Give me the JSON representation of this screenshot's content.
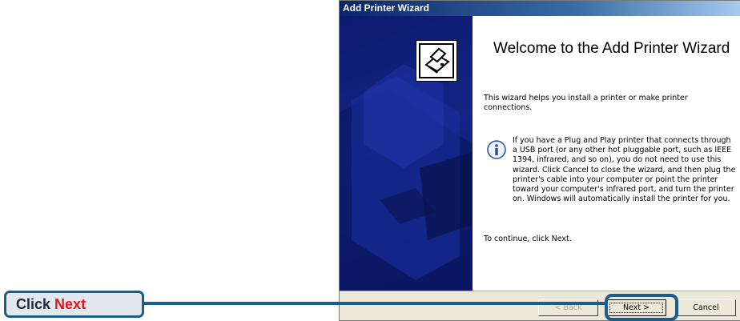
{
  "window": {
    "title": "Add Printer Wizard"
  },
  "content": {
    "heading": "Welcome to the Add Printer Wizard",
    "intro": "This wizard helps you install a printer or make printer connections.",
    "info": "If you have a Plug and Play printer that connects through a USB port (or any other hot pluggable port, such as IEEE 1394, infrared, and so on), you do not need to use this wizard. Click Cancel to close the wizard, and then plug the printer's cable into your computer or point the printer toward your computer's infrared port, and turn the printer on. Windows will automatically install the printer for you.",
    "continue": "To continue, click Next."
  },
  "buttons": {
    "back": "< Back",
    "next": "Next >",
    "cancel": "Cancel"
  },
  "callout": {
    "prefix": "Click",
    "highlight": "Next"
  },
  "icons": {
    "printer": "printer-icon",
    "info": "info-icon"
  },
  "colors": {
    "titlebar": "#0a246a",
    "side_panel": "#132486",
    "callout_border": "#1c5d8c",
    "callout_highlight": "#e4141b",
    "dialog_face": "#ece9d8"
  }
}
